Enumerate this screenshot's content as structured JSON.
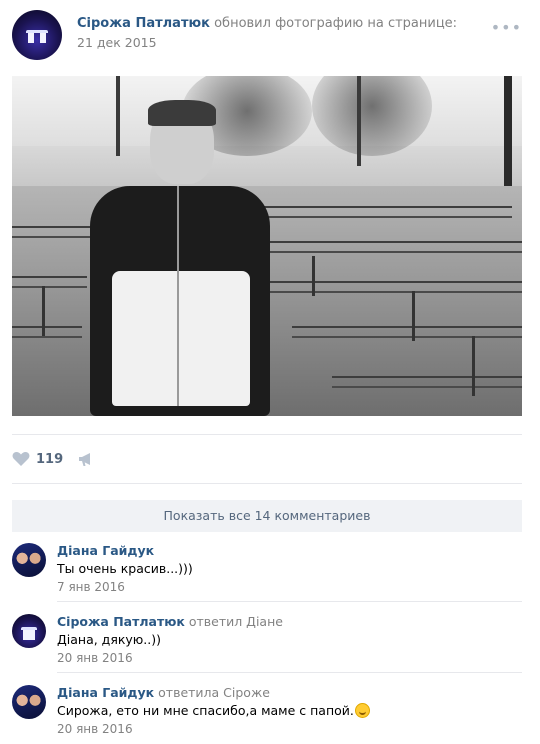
{
  "post": {
    "author": "Сірожа Патлатюк",
    "action": "обновил фотографию на странице:",
    "date": "21 дек 2015",
    "more_icon": "more-dots-icon",
    "likes_count": "119",
    "heart_icon": "heart-icon",
    "share_icon": "megaphone-share-icon"
  },
  "comments_section": {
    "show_all_label": "Показать все 14 комментариев",
    "items": [
      {
        "author": "Діана Гайдук",
        "reply_to": "",
        "text": "Ты очень красив...)))",
        "date": "7 янв 2016"
      },
      {
        "author": "Сірожа Патлатюк",
        "reply_to": "ответил Діане",
        "text": "Діана, дякую..))",
        "date": "20 янв 2016"
      },
      {
        "author": "Діана Гайдук",
        "reply_to": "ответила Сіроже",
        "text": "Сирожа, ето ни мне спасибо,а маме с папой.",
        "date": "20 янв 2016",
        "emoji": "smile-emoji-icon"
      }
    ]
  },
  "colors": {
    "link": "#2a5885",
    "muted": "#828282",
    "accent": "#55677d",
    "divider": "#e7e8ec",
    "button_bg": "#f0f2f5"
  }
}
